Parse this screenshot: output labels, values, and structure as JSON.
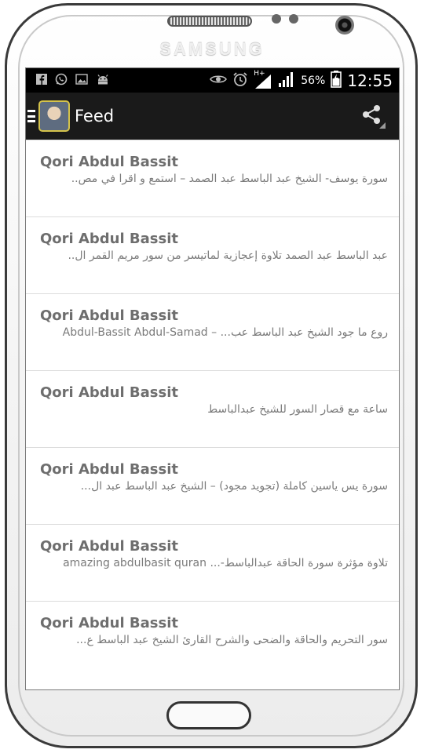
{
  "device": {
    "brand": "SAMSUNG"
  },
  "status_bar": {
    "left_icons": [
      "facebook-icon",
      "whatsapp-icon",
      "gallery-icon",
      "android-icon"
    ],
    "right_icons": [
      "eye-icon",
      "alarm-icon",
      "signal-hplus-icon",
      "signal-icon",
      "battery-icon"
    ],
    "network_label": "H+",
    "battery": "56%",
    "time": "12:55"
  },
  "action_bar": {
    "title": "Feed",
    "menu_icon": "hamburger-icon",
    "share_icon": "share-icon"
  },
  "feed": {
    "items": [
      {
        "title": "Qori Abdul Bassit",
        "subtitle": "سورة يوسف- الشيخ عبد الباسط عبد الصمد – استمع و اقرا في مص.."
      },
      {
        "title": "Qori Abdul Bassit",
        "subtitle": "عبد الباسط عبد الصمد تلاوة إعجازية لماتيسر من سور مريم القمر ال.."
      },
      {
        "title": "Qori Abdul Bassit",
        "subtitle": "روع ما جود الشيخ عبد الباسط عب... – Abdul-Bassit Abdul-Samad"
      },
      {
        "title": "Qori Abdul Bassit",
        "subtitle": "ساعة مع قصار السور للشيخ عبدالباسط"
      },
      {
        "title": "Qori Abdul Bassit",
        "subtitle": "سورة يس ياسين كاملة (تجويد مجود) – الشيخ عبد الباسط عبد ال..."
      },
      {
        "title": "Qori Abdul Bassit",
        "subtitle": "تلاوة مؤثرة سورة الحاقة عبدالباسط-... amazing abdulbasit quran"
      },
      {
        "title": "Qori Abdul Bassit",
        "subtitle": "سور التحريم والحاقة والضحى والشرح القارئ الشيخ عبد الباسط ع..."
      }
    ]
  }
}
